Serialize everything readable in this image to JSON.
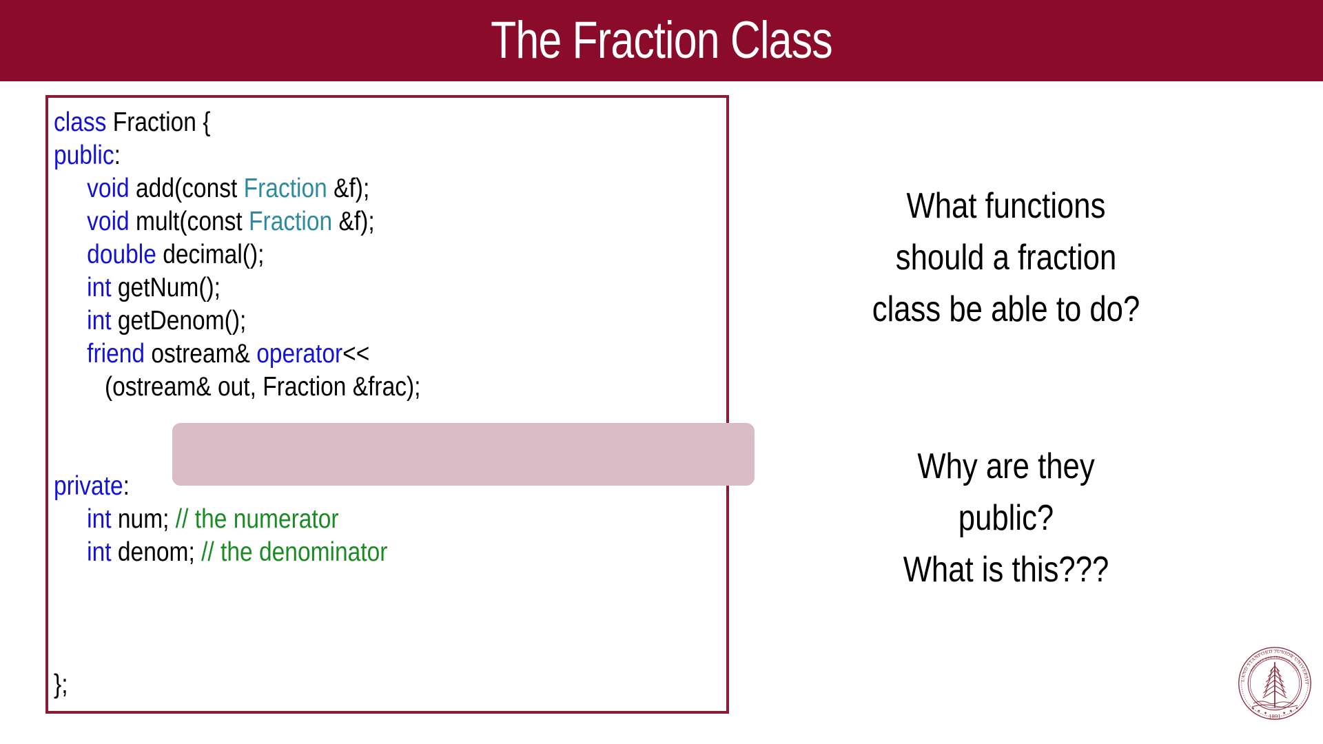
{
  "slide": {
    "title": "The Fraction Class",
    "title_bar_color": "#8a0b2a",
    "background_color": "#ffffff"
  },
  "code_panel": {
    "border_color": "#8a1c36",
    "highlight_color": "#d9bcc6",
    "syntax_colors": {
      "keyword": "#1313d6",
      "type": "#2e8b9e",
      "comment": "#1a8a22",
      "plain": "#000000"
    },
    "lines": [
      {
        "indent": 0,
        "tokens": [
          {
            "t": "class ",
            "c": "keyword"
          },
          {
            "t": "Fraction {",
            "c": "plain"
          }
        ]
      },
      {
        "indent": 0,
        "tokens": [
          {
            "t": "public",
            "c": "keyword"
          },
          {
            "t": ":",
            "c": "plain"
          }
        ]
      },
      {
        "indent": 1,
        "tokens": [
          {
            "t": "void ",
            "c": "keyword"
          },
          {
            "t": "add(const ",
            "c": "plain"
          },
          {
            "t": "Fraction ",
            "c": "type"
          },
          {
            "t": "&f);",
            "c": "plain"
          }
        ]
      },
      {
        "indent": 1,
        "tokens": [
          {
            "t": "void ",
            "c": "keyword"
          },
          {
            "t": "mult(const ",
            "c": "plain"
          },
          {
            "t": "Fraction ",
            "c": "type"
          },
          {
            "t": "&f);",
            "c": "plain"
          }
        ]
      },
      {
        "indent": 1,
        "tokens": [
          {
            "t": "double ",
            "c": "keyword"
          },
          {
            "t": "decimal();",
            "c": "plain"
          }
        ]
      },
      {
        "indent": 1,
        "tokens": [
          {
            "t": "int ",
            "c": "keyword"
          },
          {
            "t": "getNum();",
            "c": "plain"
          }
        ]
      },
      {
        "indent": 1,
        "tokens": [
          {
            "t": "int ",
            "c": "keyword"
          },
          {
            "t": "getDenom();",
            "c": "plain"
          }
        ]
      },
      {
        "indent": 1,
        "tokens": [
          {
            "t": "friend ",
            "c": "keyword"
          },
          {
            "t": "ostream& ",
            "c": "plain"
          },
          {
            "t": "operator",
            "c": "keyword"
          },
          {
            "t": "<<",
            "c": "plain"
          }
        ]
      },
      {
        "indent": 2,
        "tokens": [
          {
            "t": "(ostream& out, Fraction &frac);",
            "c": "plain"
          }
        ]
      },
      {
        "indent": 0,
        "tokens": []
      },
      {
        "indent": 0,
        "tokens": []
      },
      {
        "indent": 0,
        "tokens": [
          {
            "t": "private",
            "c": "keyword"
          },
          {
            "t": ":",
            "c": "plain"
          }
        ]
      },
      {
        "indent": 1,
        "tokens": [
          {
            "t": "int ",
            "c": "keyword"
          },
          {
            "t": "num; ",
            "c": "plain"
          },
          {
            "t": "// the numerator",
            "c": "comment"
          }
        ]
      },
      {
        "indent": 1,
        "tokens": [
          {
            "t": "int ",
            "c": "keyword"
          },
          {
            "t": "denom; ",
            "c": "plain"
          },
          {
            "t": "// the denominator",
            "c": "comment"
          }
        ]
      },
      {
        "indent": 0,
        "tokens": []
      },
      {
        "indent": 0,
        "tokens": []
      },
      {
        "indent": 0,
        "tokens": []
      },
      {
        "indent": 0,
        "tokens": [
          {
            "t": "};",
            "c": "plain"
          }
        ]
      }
    ],
    "raw_text": "class Fraction {\npublic:\n    void add(const Fraction &f);\n    void mult(const Fraction &f);\n    double decimal();\n    int getNum();\n    int getDenom();\n    friend ostream& operator<<\n      (ostream& out, Fraction &frac);\n\n\nprivate:\n    int num; // the numerator\n    int denom; // the denominator\n\n\n\n};"
  },
  "questions": [
    {
      "id": "question-1",
      "lines": [
        "What functions",
        "should a fraction",
        "class be able to do?"
      ]
    },
    {
      "id": "question-2",
      "lines": [
        "Why are they",
        "public?",
        "What is this???"
      ]
    }
  ],
  "seal": {
    "name": "stanford-seal",
    "outer_text": "LELAND STANFORD JUNIOR UNIVERSITY",
    "motto": "DIE LUFT DER FREIHEIT WEHT",
    "year": "1891",
    "color": "#8a2a3c"
  }
}
